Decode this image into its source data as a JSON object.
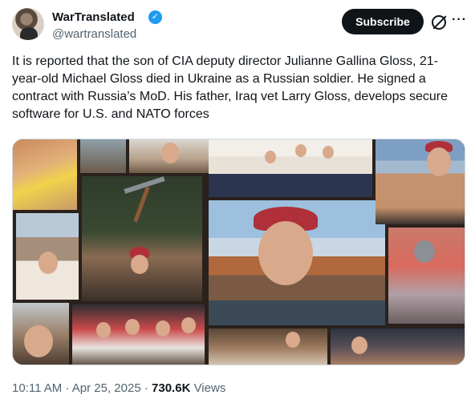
{
  "author": {
    "display_name": "WarTranslated",
    "handle": "@wartranslated",
    "verified_icon": "verified-badge-icon"
  },
  "actions": {
    "subscribe_label": "Subscribe",
    "grok_icon": "grok-icon",
    "more_icon": "more-options-icon",
    "more_glyph": "···"
  },
  "tweet": {
    "text": "It is reported that the son of CIA deputy director Julianne Gallina Gloss, 21-year-old Michael Gloss died in Ukraine as a Russian soldier. He signed a contract with Russia’s MoD. His father, Iraq vet Larry Gloss, develops secure software for U.S. and NATO forces"
  },
  "meta": {
    "time": "10:11 AM",
    "separator": "·",
    "date": "Apr 25, 2025",
    "views_count": "730.6K",
    "views_label": "Views"
  },
  "colors": {
    "text_primary": "#0f1419",
    "text_secondary": "#536471",
    "verified_blue": "#1d9bf0",
    "button_bg": "#0f1419"
  }
}
